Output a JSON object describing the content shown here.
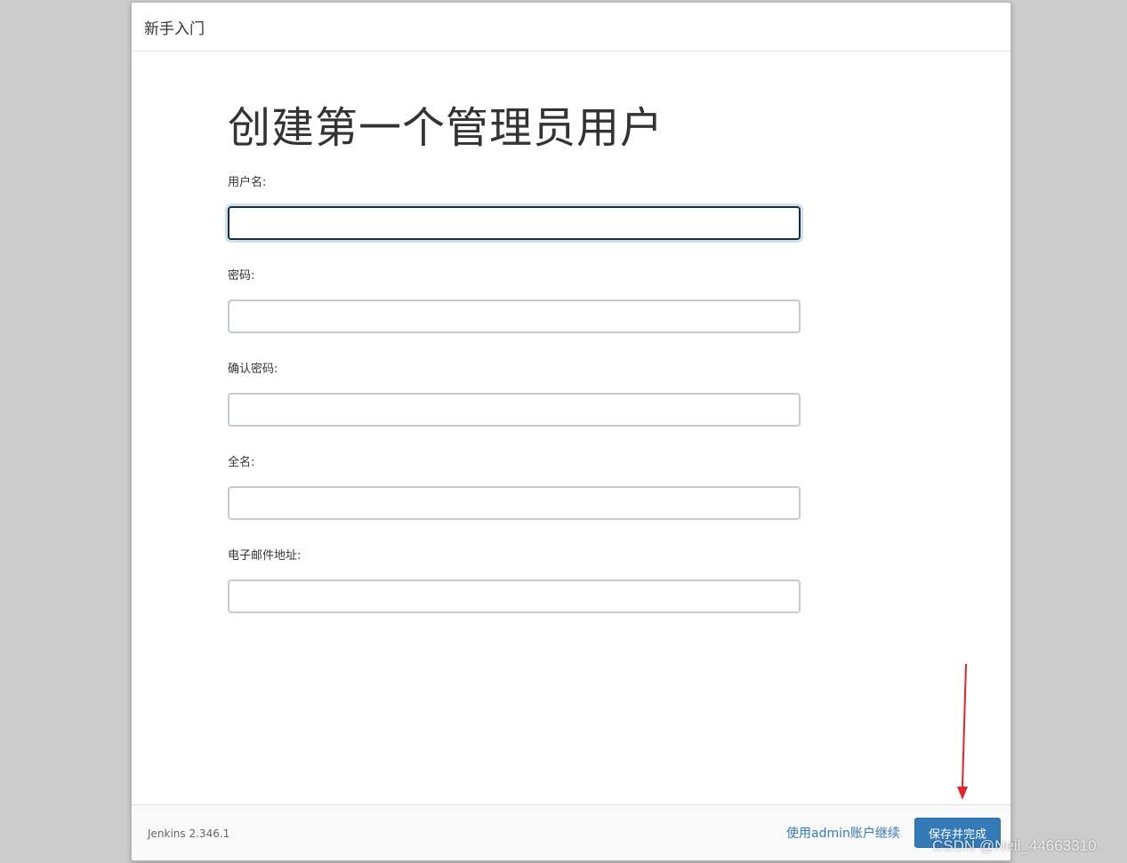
{
  "dialog": {
    "title": "新手入门"
  },
  "page": {
    "heading": "创建第一个管理员用户"
  },
  "form": {
    "username_label": "用户名:",
    "username_value": "",
    "password_label": "密码:",
    "password_value": "",
    "confirm_password_label": "确认密码:",
    "confirm_password_value": "",
    "fullname_label": "全名:",
    "fullname_value": "",
    "email_label": "电子邮件地址:",
    "email_value": ""
  },
  "footer": {
    "version": "Jenkins 2.346.1",
    "skip_link": "使用admin账户继续",
    "save_button": "保存并完成"
  },
  "annotation": {
    "arrow_color": "#e0262b",
    "watermark": "CSDN @Neil_44663310"
  },
  "colors": {
    "primary": "#337ab7",
    "background": "#cccccc"
  }
}
